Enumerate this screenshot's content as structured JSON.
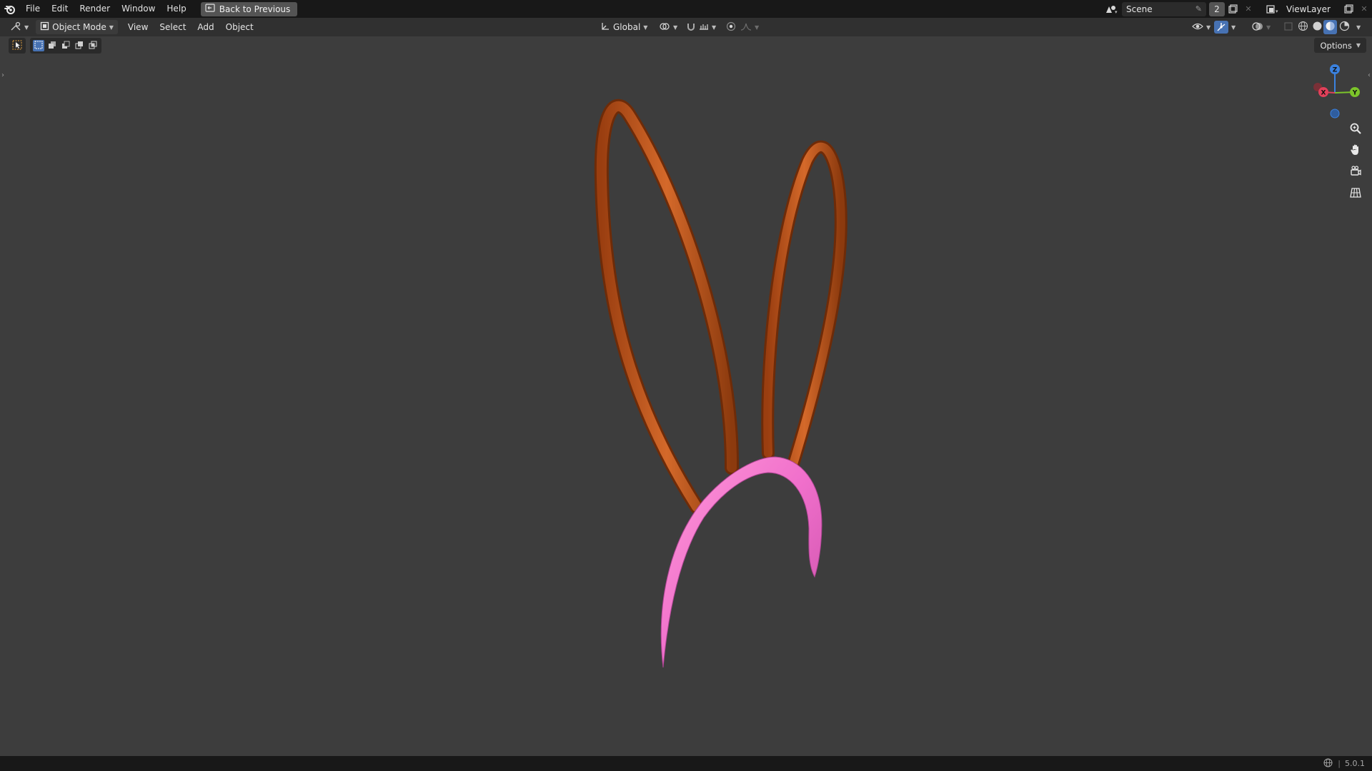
{
  "topbar": {
    "menus": [
      "File",
      "Edit",
      "Render",
      "Window",
      "Help"
    ],
    "back_button": "Back to Previous",
    "scene_name": "Scene",
    "scene_users": "2",
    "view_layer": "ViewLayer"
  },
  "header": {
    "mode": "Object Mode",
    "menus": [
      "View",
      "Select",
      "Add",
      "Object"
    ],
    "transform_orientation": "Global"
  },
  "toolbar": {
    "options_label": "Options"
  },
  "gizmo": {
    "x_label": "X",
    "y_label": "Y",
    "z_label": "Z",
    "x_color": "#e2405a",
    "y_color": "#7cc52a",
    "z_color": "#3b82e0"
  },
  "model": {
    "headband_color": "#f06fcb",
    "ears_color": "#c85a1c"
  },
  "status": {
    "version": "5.0.1"
  }
}
